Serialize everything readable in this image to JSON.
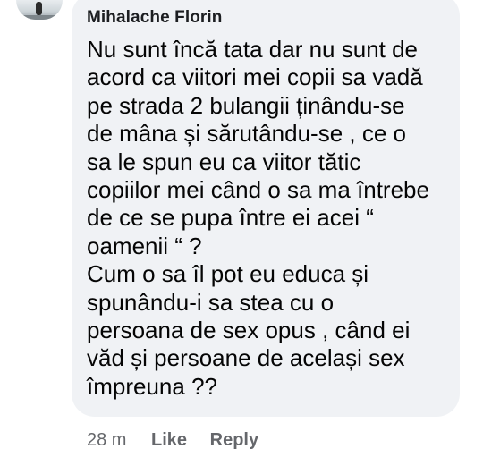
{
  "comment": {
    "author": "Mihalache Florin",
    "lines": [
      "Nu sunt încă tata dar nu sunt de",
      "acord ca viitori mei copii sa vadă",
      "pe strada 2 bulangii ținându-se",
      "de mâna și sărutându-se , ce o",
      "sa le spun eu ca viitor tătic",
      "copiilor mei când o sa ma întrebe",
      "de ce se pupa între ei acei “",
      "oamenii “ ?",
      "Cum o sa îl pot eu educa și",
      "spunându-i sa stea cu o",
      "persoana de sex opus , când ei",
      "văd și persoane de același sex",
      "împreuna ??"
    ],
    "time": "28 m",
    "like_label": "Like",
    "reply_label": "Reply"
  },
  "colors": {
    "bubble": "#f0f2f5",
    "text": "#050505",
    "meta": "#65676b"
  }
}
